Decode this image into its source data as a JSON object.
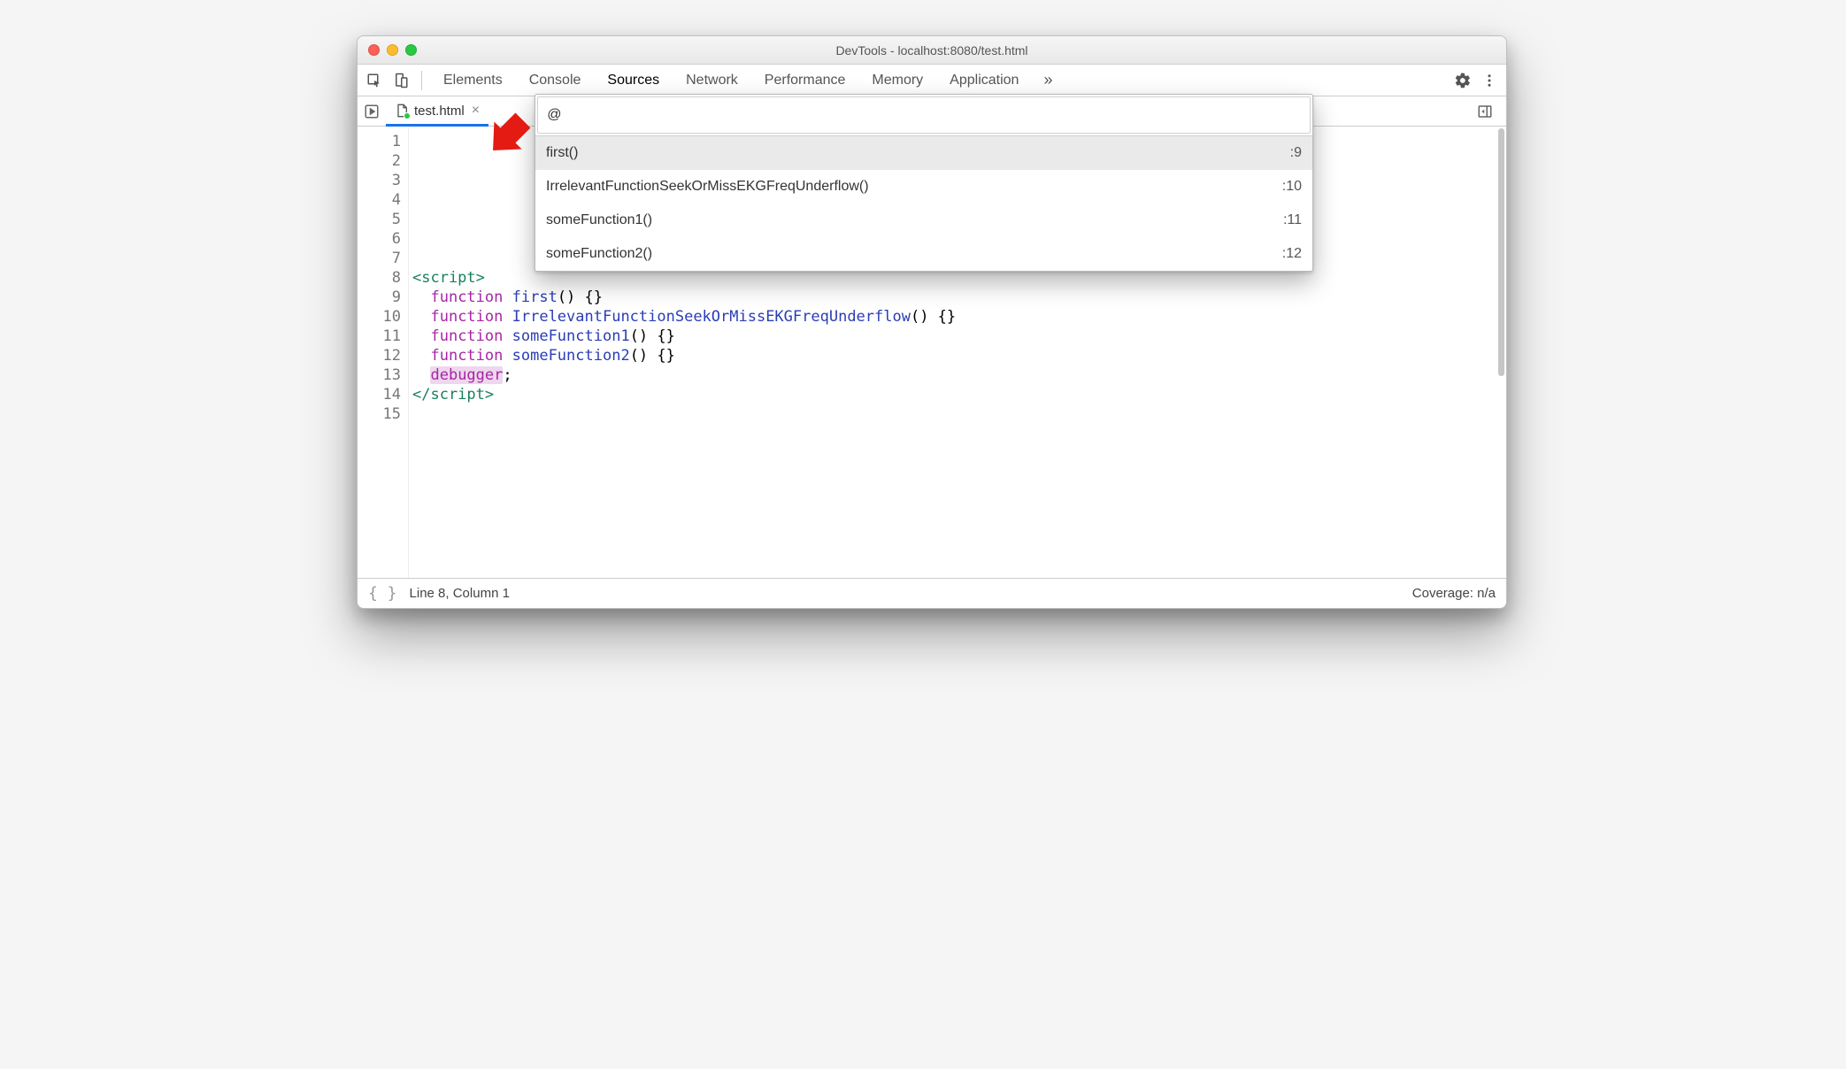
{
  "window": {
    "title": "DevTools - localhost:8080/test.html"
  },
  "tabs": {
    "items": [
      "Elements",
      "Console",
      "Sources",
      "Network",
      "Performance",
      "Memory",
      "Application"
    ],
    "selected": "Sources"
  },
  "file_tab": {
    "name": "test.html"
  },
  "popup": {
    "query": "@",
    "items": [
      {
        "label": "first()",
        "line": ":9",
        "selected": true
      },
      {
        "label": "IrrelevantFunctionSeekOrMissEKGFreqUnderflow()",
        "line": ":10",
        "selected": false
      },
      {
        "label": "someFunction1()",
        "line": ":11",
        "selected": false
      },
      {
        "label": "someFunction2()",
        "line": ":12",
        "selected": false
      }
    ]
  },
  "code": {
    "line_count": 15,
    "lines": [
      {
        "n": 1,
        "tokens": []
      },
      {
        "n": 2,
        "tokens": []
      },
      {
        "n": 3,
        "tokens": []
      },
      {
        "n": 4,
        "tokens": []
      },
      {
        "n": 5,
        "tokens": []
      },
      {
        "n": 6,
        "tokens": []
      },
      {
        "n": 7,
        "tokens": []
      },
      {
        "n": 8,
        "tokens": [
          {
            "t": "<script>",
            "c": "tag"
          }
        ]
      },
      {
        "n": 9,
        "tokens": [
          {
            "t": "  ",
            "c": ""
          },
          {
            "t": "function",
            "c": "kw"
          },
          {
            "t": " ",
            "c": ""
          },
          {
            "t": "first",
            "c": "fnname"
          },
          {
            "t": "() {}",
            "c": "punc"
          }
        ]
      },
      {
        "n": 10,
        "tokens": [
          {
            "t": "  ",
            "c": ""
          },
          {
            "t": "function",
            "c": "kw"
          },
          {
            "t": " ",
            "c": ""
          },
          {
            "t": "IrrelevantFunctionSeekOrMissEKGFreqUnderflow",
            "c": "fnname"
          },
          {
            "t": "() {}",
            "c": "punc"
          }
        ]
      },
      {
        "n": 11,
        "tokens": [
          {
            "t": "  ",
            "c": ""
          },
          {
            "t": "function",
            "c": "kw"
          },
          {
            "t": " ",
            "c": ""
          },
          {
            "t": "someFunction1",
            "c": "fnname"
          },
          {
            "t": "() {}",
            "c": "punc"
          }
        ]
      },
      {
        "n": 12,
        "tokens": [
          {
            "t": "  ",
            "c": ""
          },
          {
            "t": "function",
            "c": "kw"
          },
          {
            "t": " ",
            "c": ""
          },
          {
            "t": "someFunction2",
            "c": "fnname"
          },
          {
            "t": "() {}",
            "c": "punc"
          }
        ]
      },
      {
        "n": 13,
        "tokens": [
          {
            "t": "  ",
            "c": ""
          },
          {
            "t": "debugger",
            "c": "debug"
          },
          {
            "t": ";",
            "c": "punc"
          }
        ]
      },
      {
        "n": 14,
        "tokens": [
          {
            "t": "</script>",
            "c": "tag"
          }
        ]
      },
      {
        "n": 15,
        "tokens": []
      }
    ]
  },
  "statusbar": {
    "position": "Line 8, Column 1",
    "coverage": "Coverage: n/a"
  }
}
